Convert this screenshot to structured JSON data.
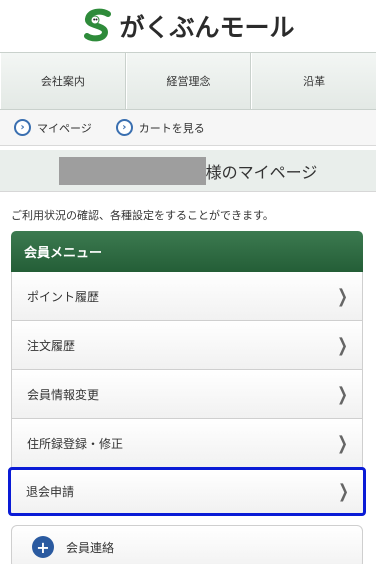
{
  "header": {
    "logo_text": "がくぶんモール"
  },
  "topnav": {
    "items": [
      {
        "label": "会社案内"
      },
      {
        "label": "経営理念"
      },
      {
        "label": "沿革"
      }
    ]
  },
  "subnav": {
    "mypage_label": "マイページ",
    "cart_label": "カートを見る"
  },
  "title": {
    "suffix": "様のマイページ"
  },
  "intro": {
    "text": "ご利用状況の確認、各種設定をすることができます。"
  },
  "menu": {
    "header": "会員メニュー",
    "items": [
      {
        "label": "ポイント履歴"
      },
      {
        "label": "注文履歴"
      },
      {
        "label": "会員情報変更"
      },
      {
        "label": "住所録登録・修正"
      },
      {
        "label": "退会申請"
      }
    ]
  },
  "contact": {
    "label": "会員連絡"
  },
  "colors": {
    "brand_green": "#245e37",
    "highlight": "#0a1bd6",
    "link_blue": "#3a6fb0"
  }
}
